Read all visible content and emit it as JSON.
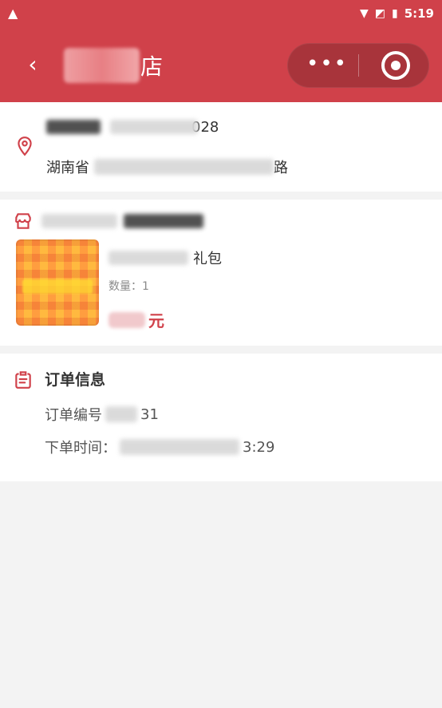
{
  "status_bar": {
    "time": "5:19",
    "warning_icon": "warning-icon",
    "wifi_icon": "wifi-icon",
    "signal_icon": "signal-icon",
    "battery_icon": "battery-icon"
  },
  "header": {
    "title_visible": "店",
    "back_icon": "back-icon",
    "menu_icon": "more-icon",
    "close_icon": "close-miniapp-icon",
    "brand_color": "#d0414a"
  },
  "address": {
    "phone_tail": "028",
    "line": "湖南省",
    "line_tail": "路"
  },
  "shop": {
    "product_title_tail": "礼包",
    "quantity": "数量：1",
    "price_unit": "元"
  },
  "order": {
    "section_title": "订单信息",
    "order_no_label": "订单编号",
    "order_no_tail": "31",
    "order_time_label": "下单时间：",
    "order_time_tail": "3:29"
  }
}
